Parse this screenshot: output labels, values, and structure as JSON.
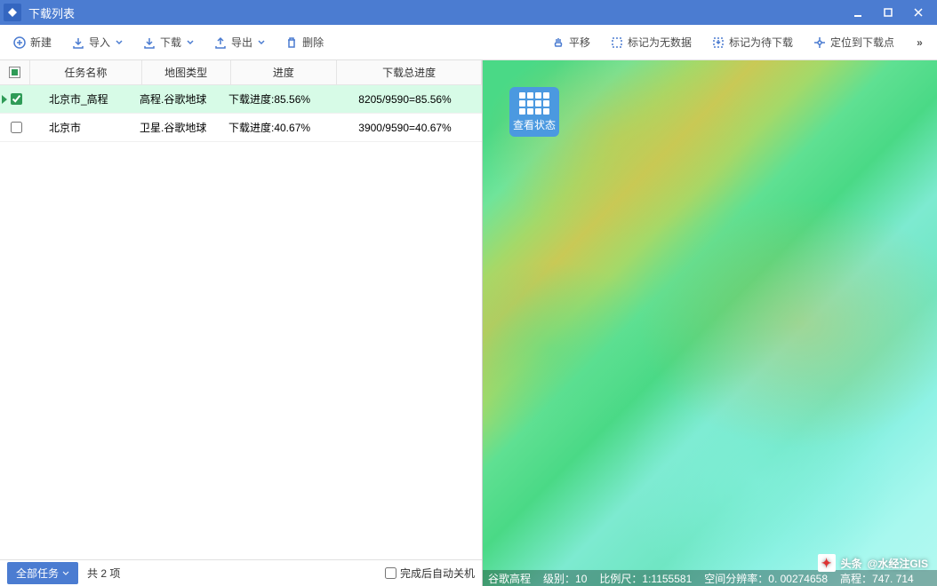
{
  "window": {
    "title": "下载列表"
  },
  "toolbar": {
    "new": "新建",
    "import": "导入",
    "download": "下载",
    "export": "导出",
    "delete": "删除",
    "pan": "平移",
    "markNoData": "标记为无数据",
    "markPending": "标记为待下载",
    "locate": "定位到下载点"
  },
  "table": {
    "head": {
      "name": "任务名称",
      "type": "地图类型",
      "progress": "进度",
      "total": "下载总进度"
    },
    "rows": [
      {
        "selected": true,
        "checked": true,
        "name": "北京市_高程",
        "type": "高程.谷歌地球",
        "progress": "下载进度:85.56%",
        "total": "8205/9590=85.56%"
      },
      {
        "selected": false,
        "checked": false,
        "name": "北京市",
        "type": "卫星.谷歌地球",
        "progress": "下载进度:40.67%",
        "total": "3900/9590=40.67%"
      }
    ]
  },
  "footer": {
    "allTasks": "全部任务",
    "count": "共 2 项",
    "autoShutdown": "完成后自动关机"
  },
  "map": {
    "overlayButton": "查看状态",
    "status": {
      "layer": "谷歌高程",
      "levelLabel": "级别：",
      "level": "10",
      "scaleLabel": "比例尺：",
      "scale": "1:1155581",
      "resLabel": "空间分辨率：",
      "res": "0. 00274658",
      "elevLabel": "高程：",
      "elev": "747. 714"
    }
  },
  "watermark": {
    "prefix": "头条",
    "text": "@水经注GIS"
  }
}
